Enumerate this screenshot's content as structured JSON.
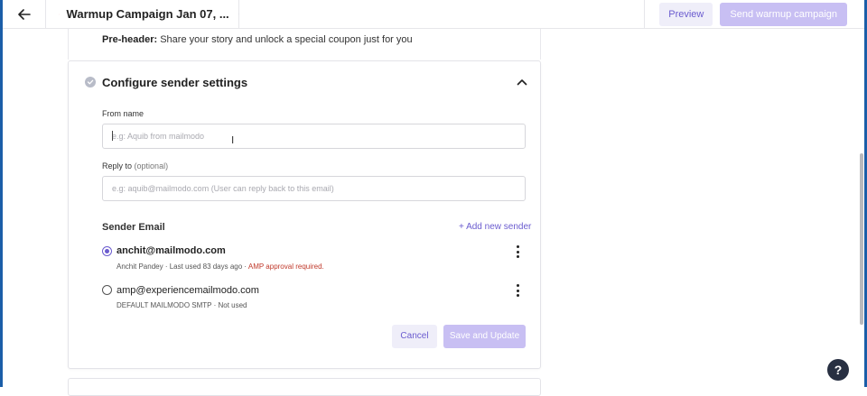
{
  "header": {
    "campaign_title": "Warmup Campaign Jan 07, ...",
    "preview_label": "Preview",
    "send_label": "Send warmup campaign"
  },
  "preheader": {
    "label": "Pre-header:",
    "text": "Share your story and unlock a special coupon just for you"
  },
  "sender_settings": {
    "title": "Configure sender settings",
    "from_name": {
      "label": "From name",
      "placeholder": "e.g: Aquib from mailmodo"
    },
    "reply_to": {
      "label": "Reply to",
      "optional": "(optional)",
      "placeholder": "e.g: aquib@mailmodo.com (User can reply back to this email)"
    },
    "sender_email_title": "Sender Email",
    "add_sender_label": "+ Add new sender",
    "senders": [
      {
        "email": "anchit@mailmodo.com",
        "meta": "Anchit Pandey · Last used 83 days ago ·",
        "warning": "AMP approval required.",
        "selected": true
      },
      {
        "email": "amp@experiencemailmodo.com",
        "meta": "DEFAULT MAILMODO SMTP · Not used",
        "warning": "",
        "selected": false
      }
    ],
    "cancel_label": "Cancel",
    "save_label": "Save and Update"
  },
  "help_label": "?",
  "colors": {
    "accent": "#6b5ccf",
    "accent_disabled": "#c8bff3",
    "warning": "#c0392b",
    "frame": "#1b5ea8"
  }
}
